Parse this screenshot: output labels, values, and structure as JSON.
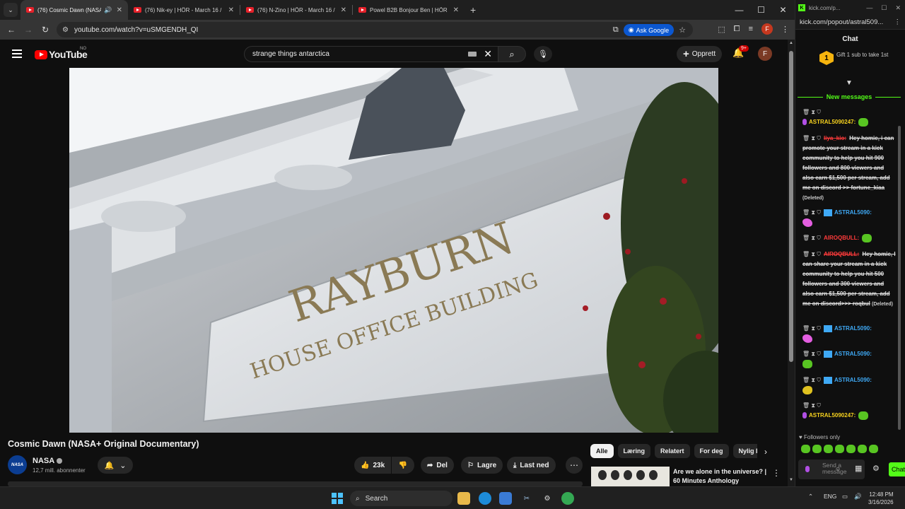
{
  "browser": {
    "tabs": [
      {
        "title": "(76) Cosmic Dawn (NASA+",
        "active": true,
        "audio": true
      },
      {
        "title": "(76) Nik-ey | HÖR - March 16 /",
        "active": false
      },
      {
        "title": "(76) N-Zino | HÖR - March 16 /",
        "active": false
      },
      {
        "title": "Powel B2B Bonjour Ben | HÖR -",
        "active": false
      }
    ],
    "url": "youtube.com/watch?v=uSMGENDH_QI",
    "ask_google_label": "Ask Google",
    "profile_initial": "F"
  },
  "youtube": {
    "logo_text": "YouTube",
    "country_code": "NO",
    "search_query": "strange things antarctica",
    "create_label": "Opprett",
    "notification_count": "9+",
    "avatar_initial": "F",
    "video": {
      "sign_line1": "RAYBURN",
      "sign_line2": "HOUSE OFFICE BUILDING",
      "title": "Cosmic Dawn (NASA+ Original Documentary)",
      "channel": "NASA",
      "channel_logo_text": "NASA",
      "subscribers": "12,7 mill. abonnenter",
      "likes": "23k",
      "share_label": "Del",
      "save_label": "Lagre",
      "download_label": "Last ned"
    },
    "chips": [
      "Alle",
      "Læring",
      "Relatert",
      "For deg",
      "Nylig la"
    ],
    "recommendation": {
      "title": "Are we alone in the universe? | 60 Minutes Anthology"
    }
  },
  "kick": {
    "window_title": "kick.com/p...",
    "url": "kick.com/popout/astral509...",
    "chat_title": "Chat",
    "gift_number": "1",
    "gift_text": "Gift 1 sub to take 1st",
    "new_messages_label": "New messages",
    "messages": [
      {
        "user": "ASTRAL5090247:",
        "color": "yellow",
        "text": "",
        "emote": "green"
      },
      {
        "user": "liya_kio:",
        "color": "red",
        "text": "Hey homie, i can promote your stream in a kick community to help you hit 900 followers and 800 viewers and also earn $1,500 per stream, add me on discord >> fortune_kiaa",
        "deleted": "(Deleted)"
      },
      {
        "user": "ASTRAL5090:",
        "color": "blue",
        "text": "",
        "emote": "pink"
      },
      {
        "user": "AIROQBULL:",
        "color": "red",
        "text": "",
        "emote": "green"
      },
      {
        "user": "AIROQBULL:",
        "color": "red",
        "text": "Hey homie, I can share your stream in a kick community to help you hit 500 followers and 300 viewers and also earn $1,500 per stream, add me on discord>>> roqbul",
        "deleted": "(Deleted)"
      },
      {
        "user": "ASTRAL5090:",
        "color": "blue",
        "text": "",
        "emote": "pink"
      },
      {
        "user": "ASTRAL5090:",
        "color": "blue",
        "text": "",
        "emote": "green"
      },
      {
        "user": "ASTRAL5090:",
        "color": "blue",
        "text": "",
        "emote": "yellow"
      },
      {
        "user": "ASTRAL5090247:",
        "color": "yellow",
        "text": "",
        "emote": "green"
      }
    ],
    "followers_only_label": "Followers only",
    "chat_placeholder": "Send a message",
    "send_label": "Chat"
  },
  "taskbar": {
    "search_label": "Search",
    "language": "ENG",
    "time": "12:48 PM",
    "date": "3/16/2026"
  }
}
